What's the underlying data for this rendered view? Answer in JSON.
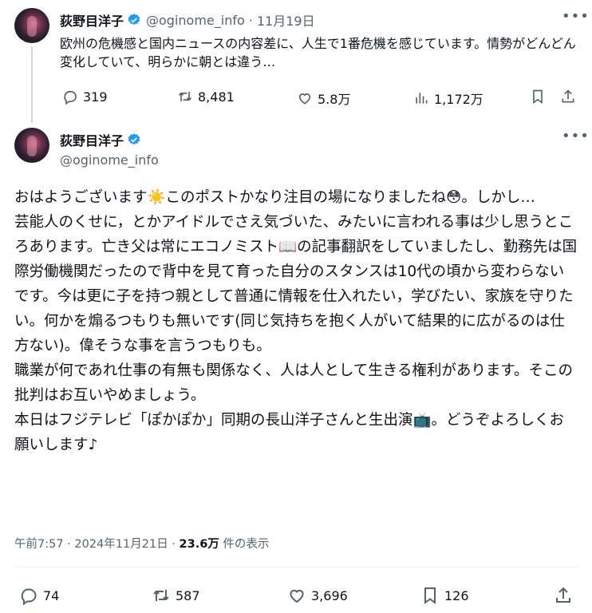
{
  "colors": {
    "accent": "#1d9bf0",
    "text": "#0f1419",
    "muted": "#536471"
  },
  "tweet1": {
    "name": "荻野目洋子",
    "handle": "@oginome_info",
    "separator": "·",
    "date": "11月19日",
    "text": "欧州の危機感と国内ニュースの内容差に、人生で1番危機を感じています。情勢がどんどん変化していて、明らかに朝とは違う…",
    "replies": "319",
    "reposts": "8,481",
    "likes": "5.8万",
    "views": "1,172万"
  },
  "tweet2": {
    "name": "荻野目洋子",
    "handle": "@oginome_info",
    "lines": [
      "おはようございます☀️このポストかなり注目の場になりましたね😳。しかし…",
      "芸能人のくせに，とかアイドルでさえ気づいた、みたいに言われる事は少し思うところあります。亡き父は常にエコノミスト📖の記事翻訳をしていましたし、勤務先は国際労働機関だったので背中を見て育った自分のスタンスは10代の頃から変わらないです。今は更に子を持つ親として普通に情報を仕入れたい，学びたい、家族を守りたい。何かを煽るつもりも無いです(同じ気持ちを抱く人がいて結果的に広がるのは仕方ない)。偉そうな事を言うつもりも。",
      "職業が何であれ仕事の有無も関係なく、人は人として生きる権利があります。そこの批判はお互いやめましょう。",
      "本日はフジテレビ「ぽかぽか」同期の長山洋子さんと生出演📺。どうぞよろしくお願いします♪"
    ],
    "timestamp": "午前7:57 · 2024年11月21日 · ",
    "views_count": "23.6万",
    "views_label": " 件の表示",
    "replies": "74",
    "reposts": "587",
    "likes": "3,696",
    "bookmarks": "126"
  },
  "icons": [
    "verified-icon",
    "more-icon",
    "reply-icon",
    "repost-icon",
    "like-icon",
    "views-icon",
    "bookmark-icon",
    "share-icon"
  ]
}
